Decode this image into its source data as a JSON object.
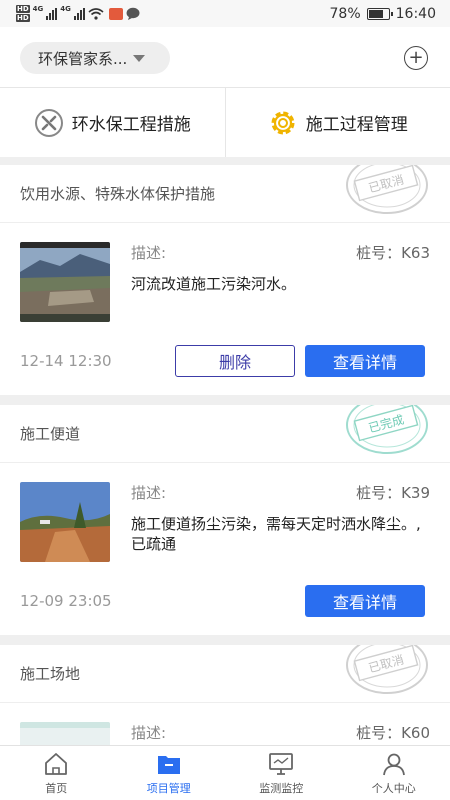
{
  "status_bar": {
    "battery": "78%",
    "time": "16:40",
    "network_a": "4G",
    "network_b": "4G",
    "battery_level": 0.78
  },
  "header": {
    "project_select": "环保管家系..."
  },
  "top_actions": [
    {
      "label": "环水保工程措施",
      "icon": "tools-icon"
    },
    {
      "label": "施工过程管理",
      "icon": "gear-icon"
    }
  ],
  "records": [
    {
      "category": "饮用水源、特殊水体保护措施",
      "desc_label": "描述:",
      "pile_label": "桩号：K63",
      "description": "河流改道施工污染河水。",
      "time": "12-14 12:30",
      "delete_label": "删除",
      "view_label": "查看详情",
      "stamp": "已取消",
      "stamp_color": "#c8c8c8"
    },
    {
      "category": "施工便道",
      "desc_label": "描述:",
      "pile_label": "桩号：K39",
      "description": "施工便道扬尘污染，需每天定时洒水降尘。,已疏通",
      "time": "12-09 23:05",
      "view_label": "查看详情",
      "stamp": "已完成",
      "stamp_color": "#7dd3c0"
    },
    {
      "category": "施工场地",
      "desc_label": "描述:",
      "pile_label": "桩号：K60",
      "stamp": "已取消",
      "stamp_color": "#c8c8c8"
    }
  ],
  "bottom_nav": [
    {
      "label": "首页",
      "icon": "home-icon"
    },
    {
      "label": "项目管理",
      "icon": "folder-icon",
      "active": true
    },
    {
      "label": "监测监控",
      "icon": "monitor-icon"
    },
    {
      "label": "个人中心",
      "icon": "user-icon"
    }
  ],
  "colors": {
    "accent": "#2a6ef0",
    "delete_border": "#3c3ca8"
  }
}
